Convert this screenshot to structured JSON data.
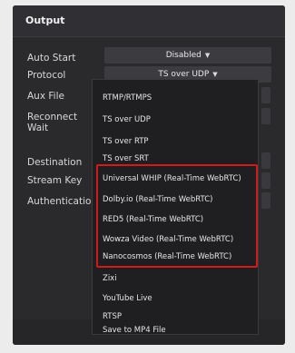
{
  "panel": {
    "title": "Output"
  },
  "rows": {
    "auto_start": "Auto Start",
    "protocol": "Protocol",
    "aux_file": "Aux File",
    "reconnect_wait": "Reconnect\nWait",
    "destination": "Destination",
    "stream_key": "Stream Key",
    "authentication": "Authentication"
  },
  "auto_start_select": {
    "value": "Disabled"
  },
  "protocol_select": {
    "value": "TS over UDP"
  },
  "dropdown": {
    "items": [
      "RTMP/RTMPS",
      "TS over UDP",
      "TS over RTP",
      "TS over SRT",
      "Universal WHIP (Real-Time WebRTC)",
      "Dolby.io (Real-Time WebRTC)",
      "RED5 (Real-Time WebRTC)",
      "Wowza Video (Real-Time WebRTC)",
      "Nanocosmos (Real-Time WebRTC)",
      "Zixi",
      "YouTube Live",
      "RTSP",
      "Save to MP4 File"
    ]
  },
  "colors": {
    "highlight": "#d11a1a",
    "panel_bg": "#2a2a2c"
  }
}
